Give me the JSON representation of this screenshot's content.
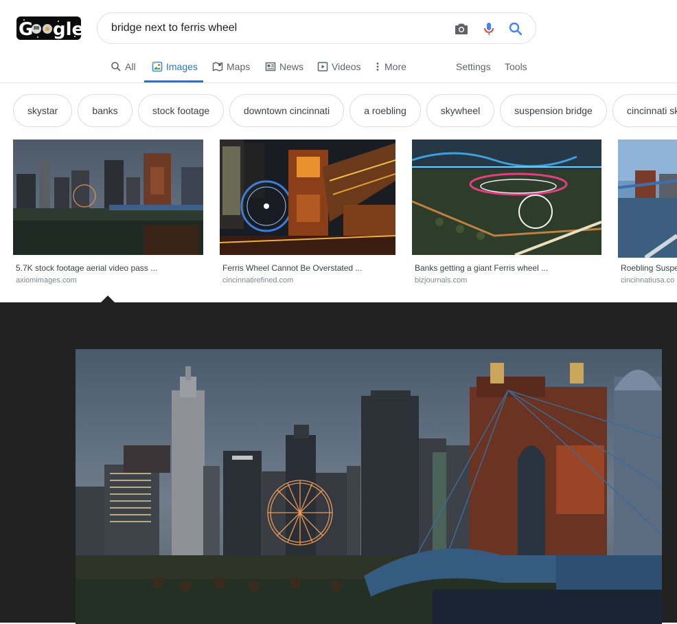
{
  "search": {
    "query": "bridge next to ferris wheel"
  },
  "logo": {
    "text": "Gℴℴgle"
  },
  "tabs": [
    {
      "label": "All",
      "icon": "search-icon"
    },
    {
      "label": "Images",
      "icon": "image-icon"
    },
    {
      "label": "Maps",
      "icon": "map-icon"
    },
    {
      "label": "News",
      "icon": "news-icon"
    },
    {
      "label": "Videos",
      "icon": "play-icon"
    },
    {
      "label": "More",
      "icon": "more-vertical-icon"
    },
    {
      "label": "Settings"
    },
    {
      "label": "Tools"
    }
  ],
  "chips": [
    "skystar",
    "banks",
    "stock footage",
    "downtown cincinnati",
    "a roebling",
    "skywheel",
    "suspension bridge",
    "cincinnati sk"
  ],
  "results": [
    {
      "title": "5.7K stock footage aerial video pass ...",
      "source": "axiomimages.com"
    },
    {
      "title": "Ferris Wheel Cannot Be Overstated ...",
      "source": "cincinnatirefined.com"
    },
    {
      "title": "Banks getting a giant Ferris wheel ...",
      "source": "bizjournals.com"
    },
    {
      "title": "Roebling Suspe",
      "source": "cincinnatiusa.co"
    }
  ],
  "colors": {
    "accent": "#1a73e8",
    "preview_bg": "#222222"
  }
}
